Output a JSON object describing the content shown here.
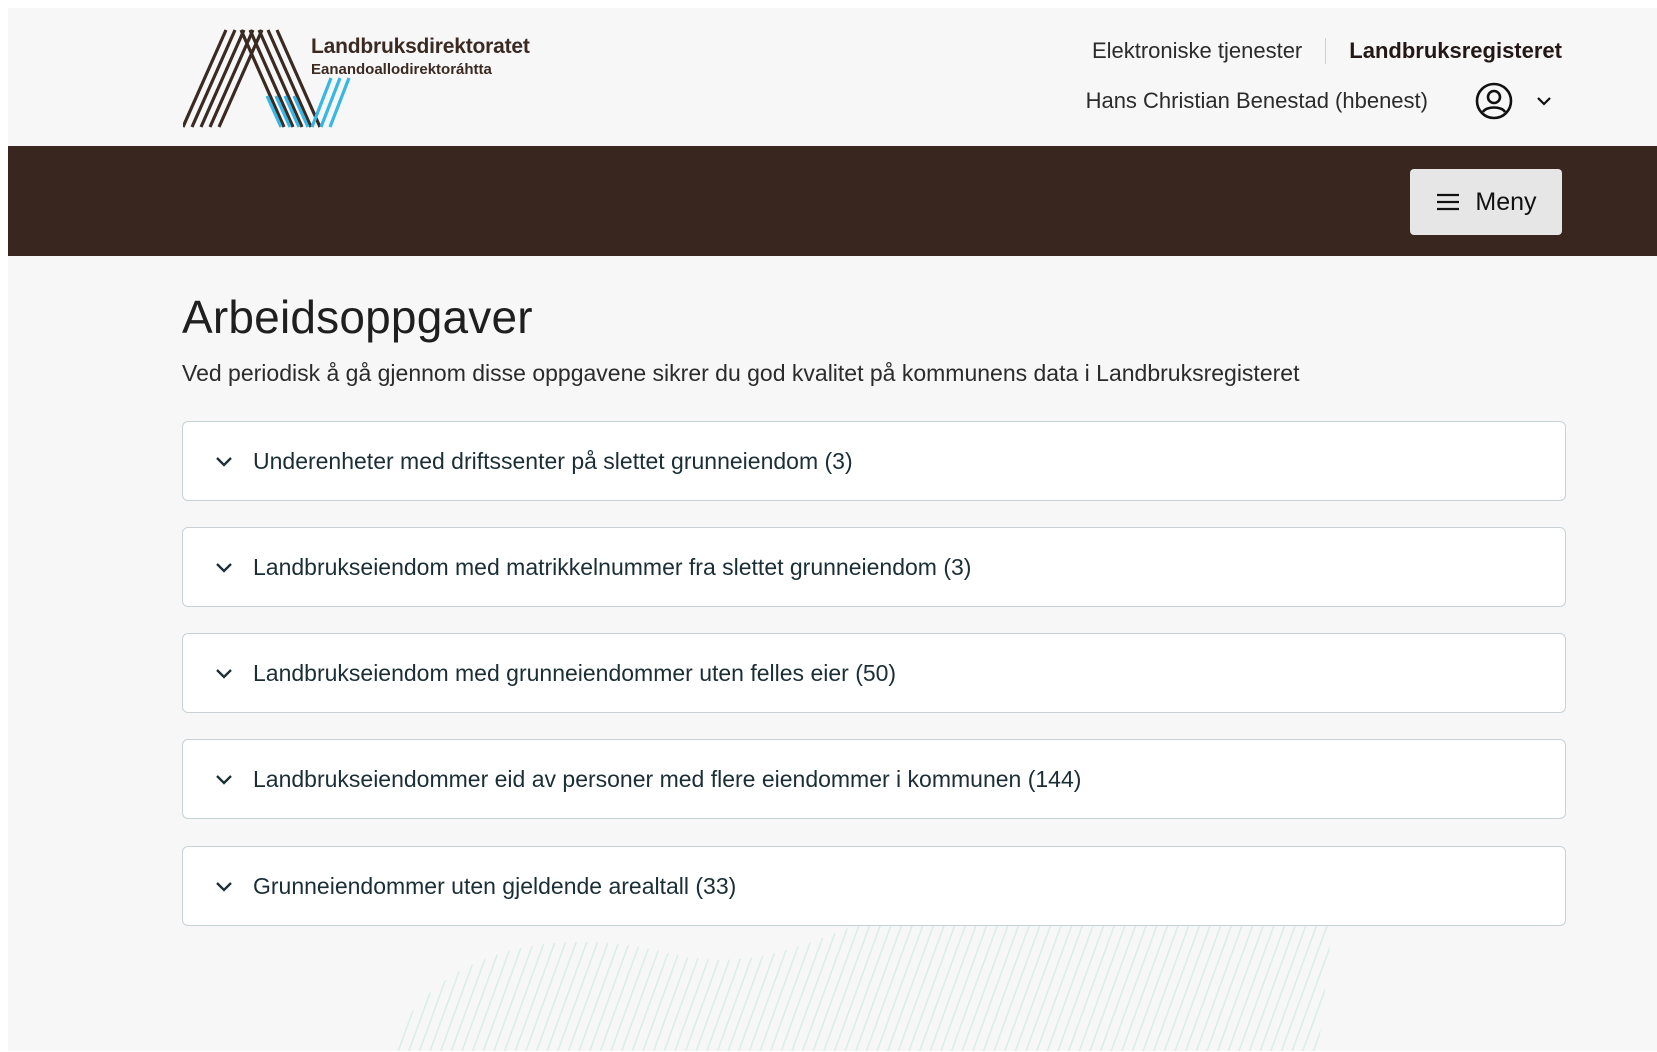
{
  "header": {
    "logo": {
      "name": "Landbruksdirektoratet",
      "subtitle": "Eanandoallodirektoráhtta"
    },
    "links": {
      "electronic_services": "Elektroniske tjenester",
      "register": "Landbruksregisteret"
    },
    "user": {
      "name": "Hans Christian Benestad (hbenest)",
      "icon": "user-circle-icon"
    }
  },
  "navbar": {
    "menu_label": "Meny",
    "menu_icon": "hamburger-icon"
  },
  "main": {
    "title": "Arbeidsoppgaver",
    "intro": "Ved periodisk å gå gjennom disse oppgavene sikrer du god kvalitet på kommunens data i Landbruksregisteret",
    "accordions": [
      {
        "label": "Underenheter med driftssenter på slettet grunneiendom (3)"
      },
      {
        "label": "Landbrukseiendom med matrikkelnummer fra slettet grunneiendom (3)"
      },
      {
        "label": "Landbrukseiendom med grunneiendommer uten felles eier (50)"
      },
      {
        "label": "Landbrukseiendommer eid av personer med flere eiendommer i kommunen (144)"
      },
      {
        "label": "Grunneiendommer uten gjeldende arealtall (33)"
      }
    ]
  },
  "colors": {
    "navbar": "#39261f",
    "logo_brown": "#3a2a22",
    "logo_blue": "#38b7e4",
    "background": "#f7f7f7",
    "card_border": "#c7d2d6"
  }
}
